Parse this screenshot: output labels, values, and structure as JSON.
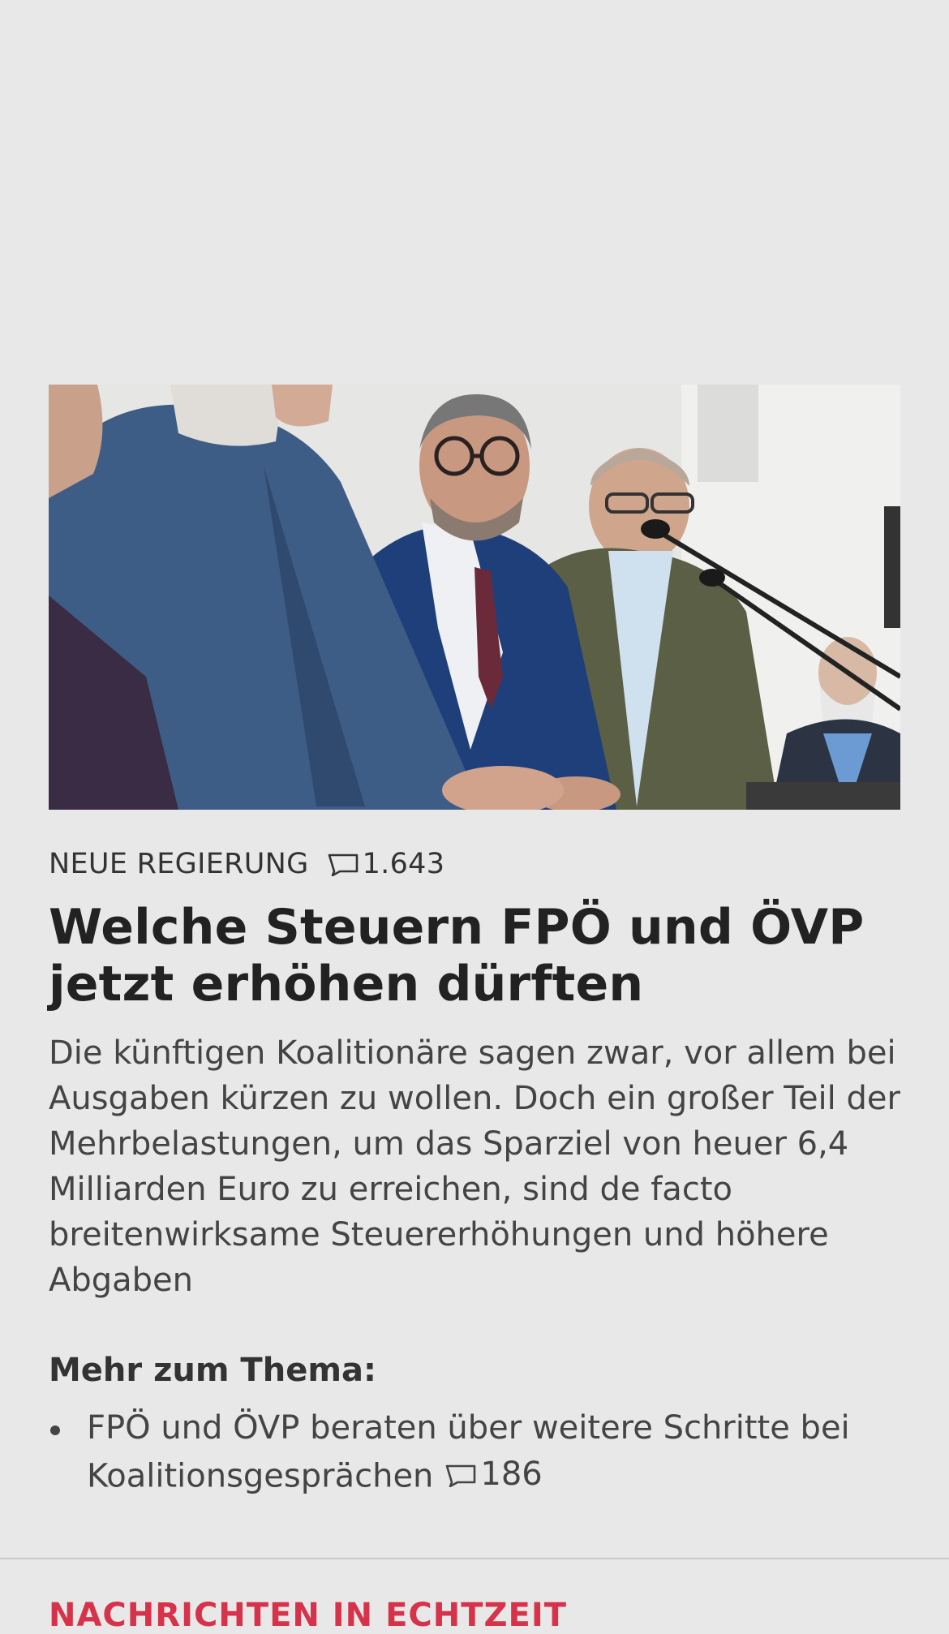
{
  "article": {
    "image_alt": "Pressekonferenz mit Herbert Kickl",
    "kicker": "NEUE REGIERUNG",
    "comment_count": "1.643",
    "headline": "Welche Steuern FPÖ und ÖVP jetzt erhöhen dürften",
    "lead": "Die künftigen Koalitionäre sagen zwar, vor allem bei Ausgaben kürzen zu wollen. Doch ein großer Teil der Mehrbelastungen, um das Sparziel von heuer 6,4 Milliarden Euro zu erreichen, sind de facto breitenwirksame Steuererhöhungen und höhere Abgaben"
  },
  "more": {
    "title": "Mehr zum Thema:",
    "items": [
      {
        "text": "FPÖ und ÖVP beraten über weitere Schritte bei Koalitionsgesprächen",
        "comment_count": "186"
      }
    ]
  },
  "next_section": {
    "title": "NACHRICHTEN IN ECHTZEIT"
  },
  "colors": {
    "background": "#e8e8e8",
    "text": "#222222",
    "accent": "#d6334a"
  },
  "icons": {
    "comment": "comment-bubble-icon"
  }
}
